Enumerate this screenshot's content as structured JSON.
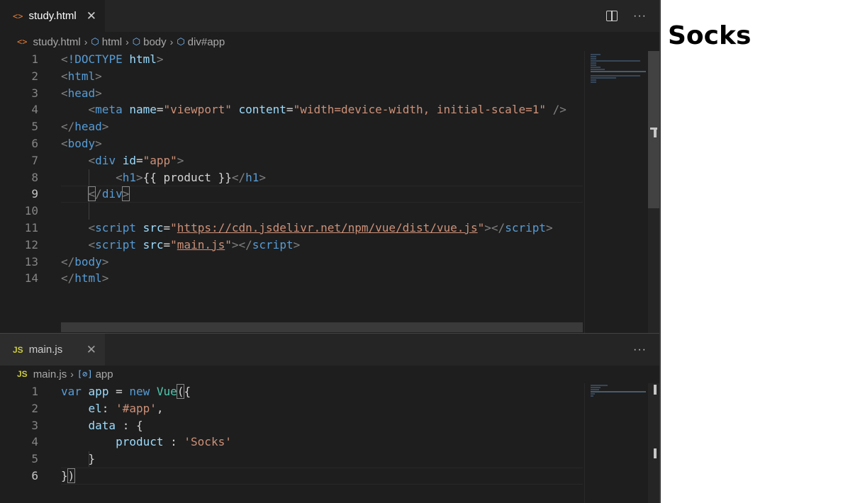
{
  "editor": {
    "top_pane": {
      "tab": {
        "icon": "<>",
        "label": "study.html",
        "close": "✕"
      },
      "actions": {
        "more": "···"
      },
      "breadcrumb": [
        "study.html",
        "html",
        "body",
        "div#app"
      ]
    },
    "bottom_pane": {
      "tab": {
        "icon": "JS",
        "label": "main.js",
        "close": "✕"
      },
      "actions": {
        "more": "···"
      },
      "breadcrumb": [
        "main.js",
        "app"
      ]
    }
  },
  "preview": {
    "heading": "Socks"
  },
  "colors": {
    "editor_bg": "#1e1e1e",
    "tag": "#569cd6",
    "attr": "#9cdcfe",
    "string": "#ce9178",
    "keyword": "#569cd6",
    "class": "#4ec9b0"
  }
}
